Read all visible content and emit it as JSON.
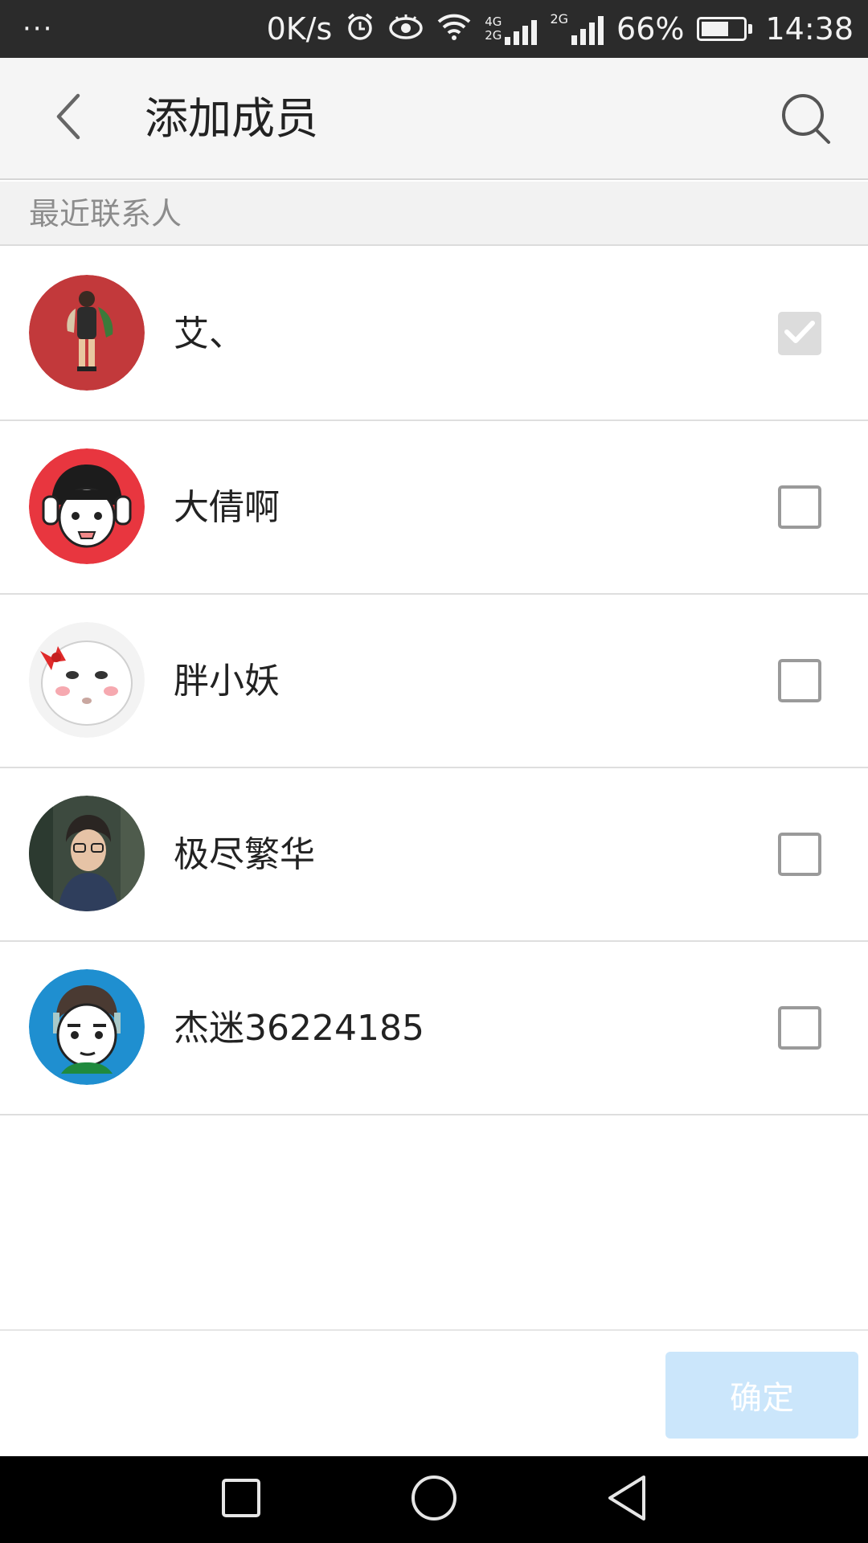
{
  "status_bar": {
    "dots": "···",
    "net_speed": "0K/s",
    "net_labels": {
      "top": "4G",
      "bottom": "2G",
      "second": "2G"
    },
    "battery_percent": "66%",
    "battery_level": 0.66,
    "time": "14:38",
    "icons": [
      "alarm-icon",
      "eye-icon",
      "wifi-icon",
      "signal-icon",
      "signal-icon",
      "battery-icon"
    ]
  },
  "header": {
    "title": "添加成员",
    "back_icon": "chevron-left-icon",
    "search_icon": "search-icon"
  },
  "section": {
    "title": "最近联系人"
  },
  "contacts": [
    {
      "name": "艾、",
      "checked": true,
      "avatar_color": "#c2393b"
    },
    {
      "name": "大倩啊",
      "checked": false,
      "avatar_color": "#e8363f"
    },
    {
      "name": "胖小妖",
      "checked": false,
      "avatar_color": "#f3f3f3"
    },
    {
      "name": "极尽繁华",
      "checked": false,
      "avatar_color": "#3d4a3f"
    },
    {
      "name": "杰迷36224185",
      "checked": false,
      "avatar_color": "#1f8fd0"
    }
  ],
  "footer": {
    "confirm_label": "确定"
  },
  "nav": {
    "icons": [
      "recent-apps-icon",
      "home-icon",
      "back-icon"
    ]
  },
  "colors": {
    "confirm_bg": "#cbe6fb",
    "header_bg": "#f5f5f5",
    "status_bg": "#2b2b2b"
  }
}
